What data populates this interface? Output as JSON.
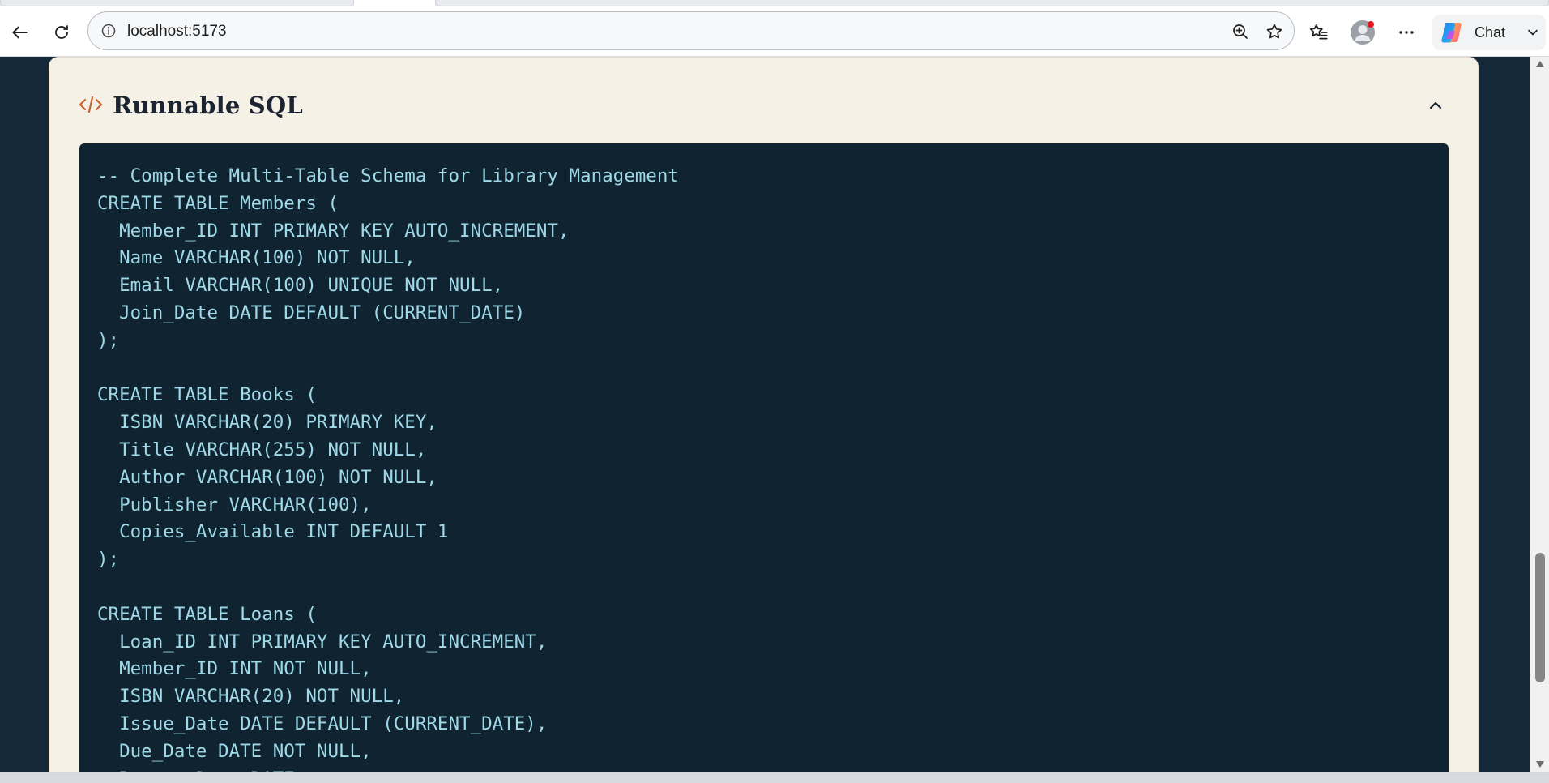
{
  "browser": {
    "address": "localhost:5173",
    "chat_label": "Chat",
    "icons": {
      "back": "back-arrow-icon",
      "refresh": "refresh-icon",
      "info": "info-icon",
      "zoom": "zoom-in-icon",
      "favorite": "star-icon",
      "favorites": "favorites-icon",
      "profile": "profile-avatar-icon",
      "more": "more-options-icon",
      "copilot": "copilot-logo-icon",
      "chevron": "chevron-down-icon"
    }
  },
  "card": {
    "title": "Runnable SQL",
    "icon": "code-brackets-icon",
    "collapse_icon": "chevron-up-icon",
    "accent_color": "#c8622e"
  },
  "code": {
    "lines": [
      "-- Complete Multi-Table Schema for Library Management",
      "CREATE TABLE Members (",
      "  Member_ID INT PRIMARY KEY AUTO_INCREMENT,",
      "  Name VARCHAR(100) NOT NULL,",
      "  Email VARCHAR(100) UNIQUE NOT NULL,",
      "  Join_Date DATE DEFAULT (CURRENT_DATE)",
      ");",
      "",
      "CREATE TABLE Books (",
      "  ISBN VARCHAR(20) PRIMARY KEY,",
      "  Title VARCHAR(255) NOT NULL,",
      "  Author VARCHAR(100) NOT NULL,",
      "  Publisher VARCHAR(100),",
      "  Copies_Available INT DEFAULT 1",
      ");",
      "",
      "CREATE TABLE Loans (",
      "  Loan_ID INT PRIMARY KEY AUTO_INCREMENT,",
      "  Member_ID INT NOT NULL,",
      "  ISBN VARCHAR(20) NOT NULL,",
      "  Issue_Date DATE DEFAULT (CURRENT_DATE),",
      "  Due_Date DATE NOT NULL,",
      "  Return_Date DATE,"
    ]
  },
  "colors": {
    "page_bg": "#14283a",
    "card_bg": "#f6f1e7",
    "code_bg": "#0f2331",
    "code_text": "#9fd9e8"
  }
}
